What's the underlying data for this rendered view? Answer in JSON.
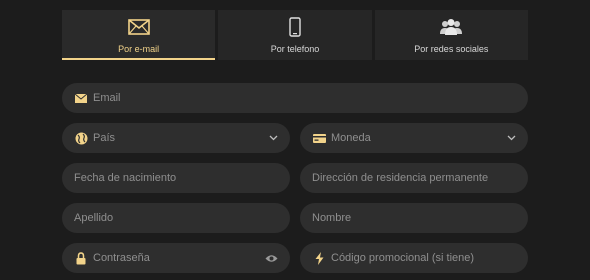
{
  "tabs": [
    {
      "label": "Por e-mail",
      "icon": "envelope-icon",
      "active": true
    },
    {
      "label": "Por telefono",
      "icon": "phone-icon",
      "active": false
    },
    {
      "label": "Por redes sociales",
      "icon": "people-icon",
      "active": false
    }
  ],
  "form": {
    "email": {
      "placeholder": "Email",
      "icon": "envelope-icon"
    },
    "country": {
      "placeholder": "País",
      "icon": "globe-icon"
    },
    "currency": {
      "placeholder": "Moneda",
      "icon": "currency-icon"
    },
    "birthdate": {
      "placeholder": "Fecha de nacimiento"
    },
    "address": {
      "placeholder": "Dirección de residencia permanente"
    },
    "lastname": {
      "placeholder": "Apellido"
    },
    "firstname": {
      "placeholder": "Nombre"
    },
    "password": {
      "placeholder": "Contraseña",
      "icon": "lock-icon",
      "trailing_icon": "eye-icon"
    },
    "promo": {
      "placeholder": "Código promocional (si tiene)",
      "icon": "lightning-icon"
    }
  },
  "colors": {
    "accent": "#f2d38a",
    "background": "#1c1c1c",
    "field": "#2e2e2e",
    "placeholder": "#8f8f8f"
  }
}
